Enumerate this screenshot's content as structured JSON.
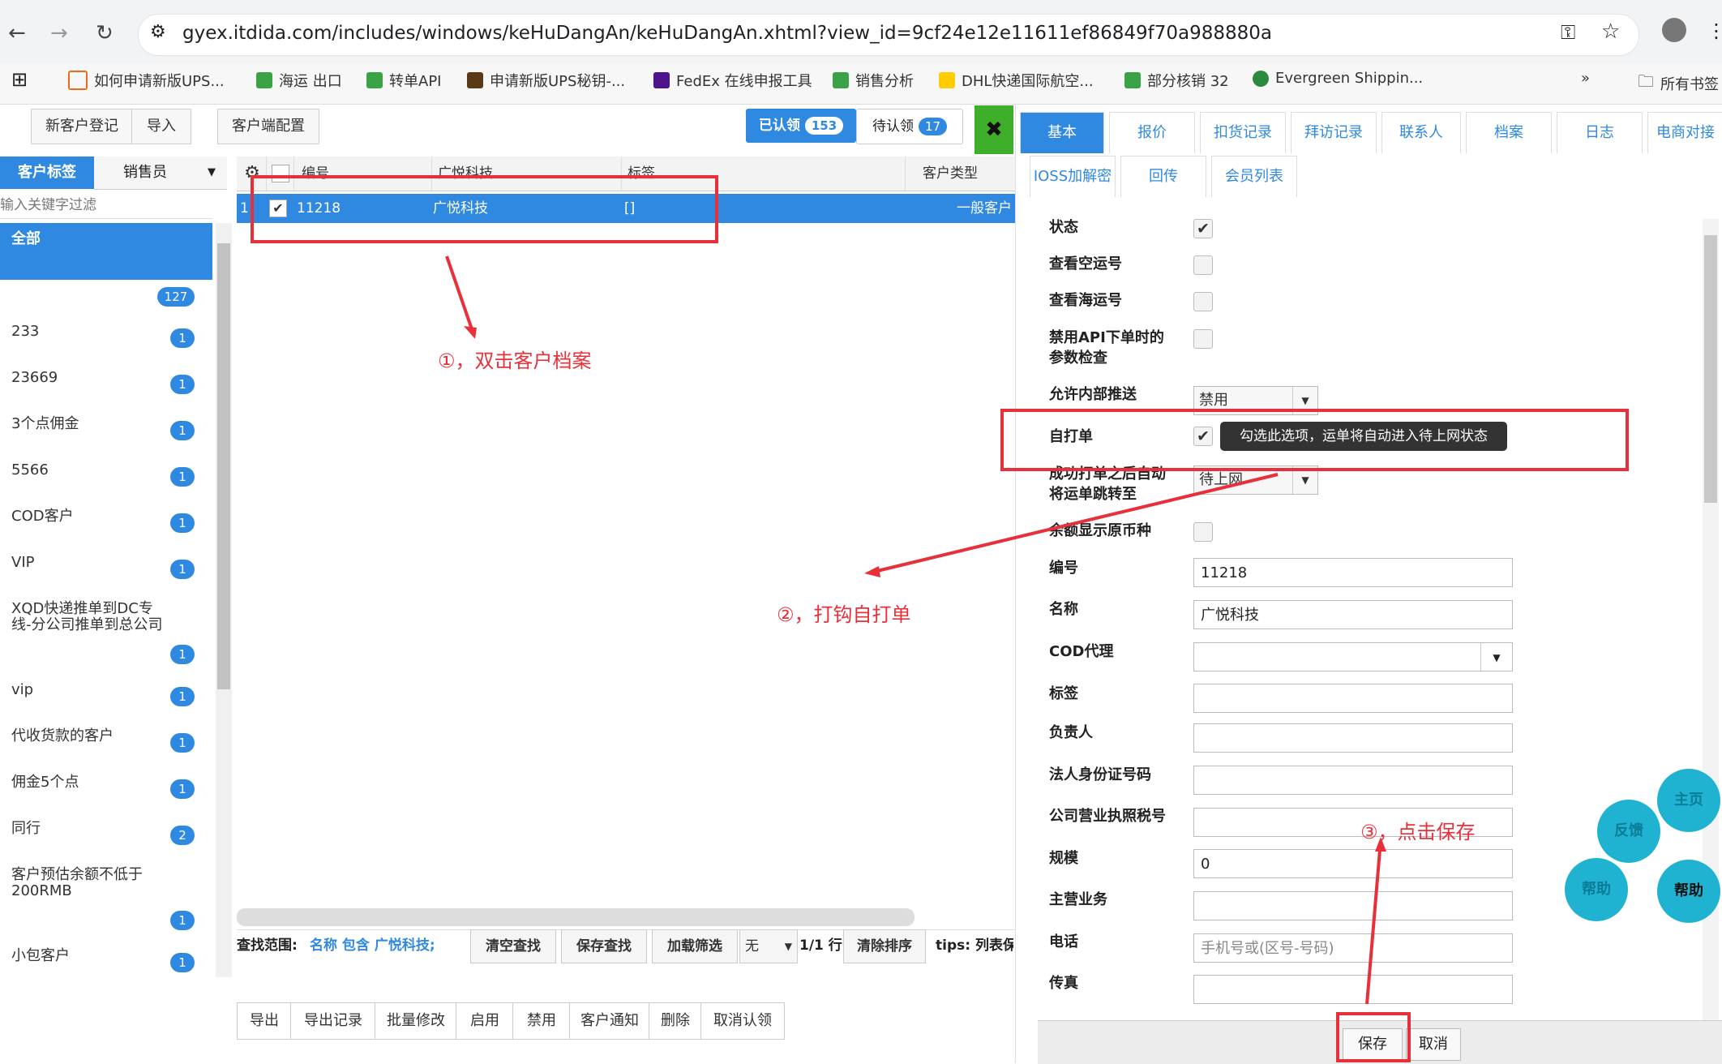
{
  "browser": {
    "url": "gyex.itdida.com/includes/windows/keHuDangAn/keHuDangAn.xhtml?view_id=9cf24e12e11611ef86849f70a988880a",
    "bookmarks": [
      "如何申请新版UPS...",
      "海运 出口",
      "转单API",
      "申请新版UPS秘钥-...",
      "FedEx 在线申报工具",
      "销售分析",
      "DHL快递国际航空...",
      "部分核销 32",
      "Evergreen Shippin..."
    ],
    "all_bookmarks": "所有书签",
    "more": "»"
  },
  "toolbar": {
    "new_customer": "新客户登记",
    "import": "导入",
    "client_config": "客户端配置",
    "claimed_label": "已认领",
    "claimed_count": "153",
    "pending_label": "待认领",
    "pending_count": "17",
    "close": "✖"
  },
  "sidebar": {
    "tab_tag": "客户标签",
    "tab_sales": "销售员",
    "filter_placeholder": "输入关键字过滤",
    "all_label": "全部",
    "items": [
      {
        "label": "",
        "count": "127"
      },
      {
        "label": "233",
        "count": "1"
      },
      {
        "label": "23669",
        "count": "1"
      },
      {
        "label": "3个点佣金",
        "count": "1"
      },
      {
        "label": "5566",
        "count": "1"
      },
      {
        "label": "COD客户",
        "count": "1"
      },
      {
        "label": "VIP",
        "count": "1"
      },
      {
        "label": "XQD快递推单到DC专线-分公司推单到总公司",
        "count": "1"
      },
      {
        "label": "vip",
        "count": "1"
      },
      {
        "label": "代收货款的客户",
        "count": "1"
      },
      {
        "label": "佣金5个点",
        "count": "1"
      },
      {
        "label": "同行",
        "count": "2"
      },
      {
        "label": "客户预估余额不低于200RMB",
        "count": "1"
      },
      {
        "label": "小包客户",
        "count": "1"
      }
    ]
  },
  "grid": {
    "headers": {
      "code": "编号",
      "company": "广悦科技",
      "tag": "标签",
      "type": "客户类型"
    },
    "row": {
      "index": "1",
      "code": "11218",
      "company": "广悦科技",
      "tag": "[]",
      "type": "一般客户"
    }
  },
  "filter": {
    "scope_label": "查找范围:",
    "scope_value": "名称 包含 广悦科技;",
    "clear": "清空查找",
    "save": "保存查找",
    "load": "加载筛选",
    "none": "无",
    "page": "1/1 行",
    "clear_sort": "清除排序",
    "tips": "tips: 列表保"
  },
  "bottom_actions": [
    "导出",
    "导出记录",
    "批量修改",
    "启用",
    "禁用",
    "客户通知",
    "删除",
    "取消认领"
  ],
  "panel": {
    "tabs_row1": [
      "基本",
      "报价",
      "扣货记录",
      "拜访记录",
      "联系人",
      "档案",
      "日志",
      "电商对接"
    ],
    "tabs_row2": [
      "IOSS加解密",
      "回传",
      "会员列表"
    ],
    "fields": {
      "status": "状态",
      "view_air": "查看空运号",
      "view_sea": "查看海运号",
      "disable_api": "禁用API下单时的参数检查",
      "allow_push": "允许内部推送",
      "allow_push_value": "禁用",
      "self_print": "自打单",
      "after_print": "成功打单之后自动将运单跳转至",
      "after_print_value": "待上网",
      "balance_currency": "余额显示原币种",
      "code": "编号",
      "code_value": "11218",
      "name": "名称",
      "name_value": "广悦科技",
      "cod_agent": "COD代理",
      "tag": "标签",
      "owner": "负责人",
      "legal_id": "法人身份证号码",
      "tax_id": "公司营业执照税号",
      "scale": "规模",
      "scale_value": "0",
      "main_business": "主营业务",
      "phone": "电话",
      "phone_placeholder": "手机号或(区号-号码)",
      "fax": "传真"
    },
    "tooltip": "勾选此选项，运单将自动进入待上网状态",
    "save": "保存",
    "cancel": "取消"
  },
  "floating": {
    "home": "主页",
    "feedback": "反馈",
    "help1": "帮助",
    "help2": "帮助"
  },
  "annotations": {
    "step1": "①，双击客户档案",
    "step2": "②，打钩自打单",
    "step3": "③，点击保存"
  }
}
